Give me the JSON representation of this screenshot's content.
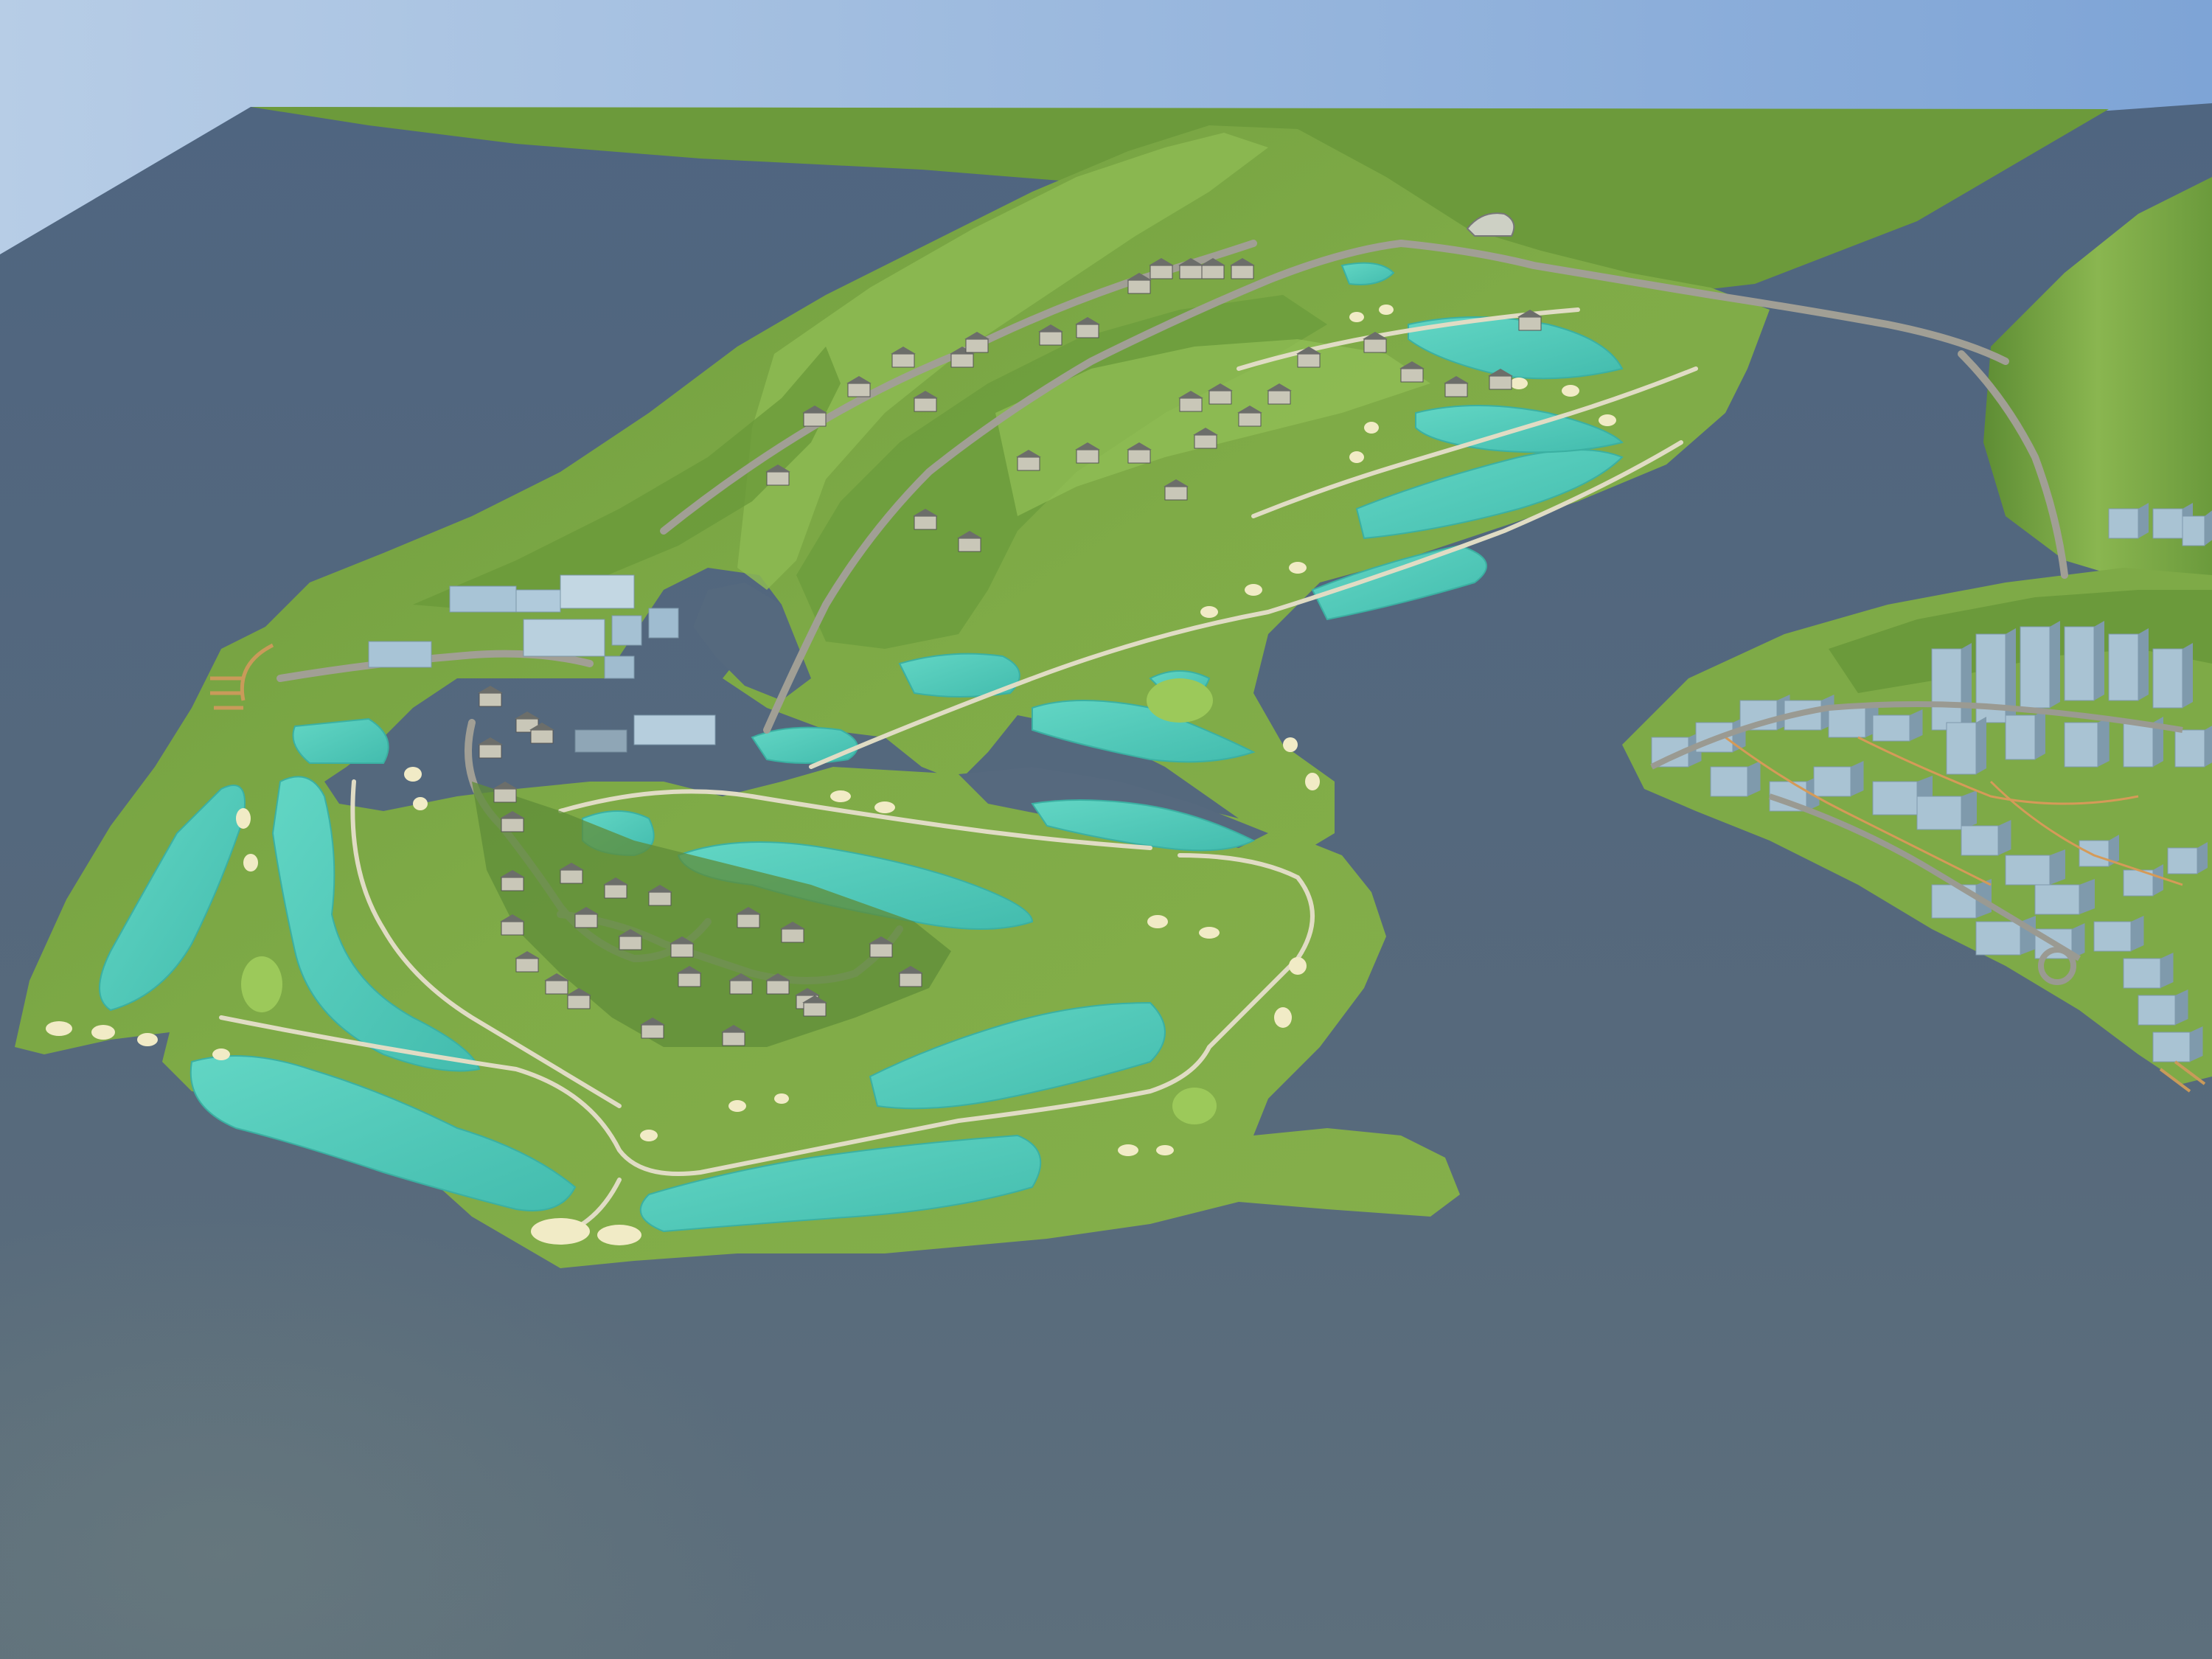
{
  "scene": {
    "kind": "3d-rendered-masterplan-aerial",
    "colors": {
      "sky_top": "#8aaad4",
      "sky_bottom": "#b7cde6",
      "water": "#53697f",
      "water_deep": "#4a6078",
      "land_far": "#6f9a3e",
      "land": "#7ba544",
      "land_light": "#8dba52",
      "land_dark": "#5c8a34",
      "fairway": "#86b64c",
      "pond": "#5fd1c0",
      "pond_edge": "#3fb7a8",
      "bunker": "#f2ecc8",
      "path": "#d9d4b8",
      "road": "#9a9a92",
      "building": "#a9c3d3",
      "building_dark": "#7f9aac",
      "villa": "#c9c7b8",
      "roof": "#6c6e6a",
      "dock": "#c99a5a"
    },
    "icons": [
      "villa-icon",
      "tower-building-icon",
      "pier-icon",
      "bunker-icon"
    ]
  }
}
